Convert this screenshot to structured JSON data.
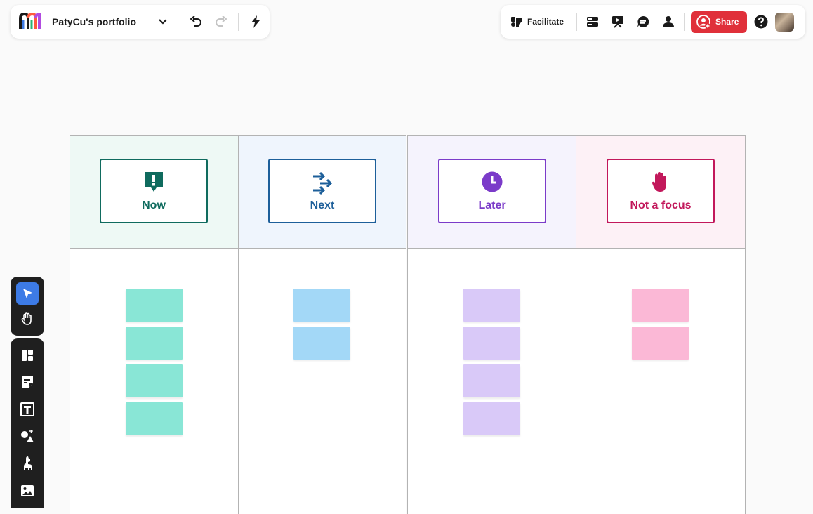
{
  "header": {
    "board_title": "PatyCu's portfolio",
    "facilitate_label": "Facilitate",
    "share_label": "Share"
  },
  "board": {
    "columns": [
      {
        "label": "Now",
        "icon": "exclamation-bubble-icon",
        "accent": "#0f6b5e",
        "header_bg": "#eef9f5",
        "sticky_color": "#89e6d6",
        "sticky_count": 4
      },
      {
        "label": "Next",
        "icon": "arrows-right-icon",
        "accent": "#1d5f9a",
        "header_bg": "#eff5fd",
        "sticky_color": "#a3d8f7",
        "sticky_count": 2
      },
      {
        "label": "Later",
        "icon": "clock-icon",
        "accent": "#7b3bc9",
        "header_bg": "#f5f3fd",
        "sticky_color": "#d9c9f8",
        "sticky_count": 4
      },
      {
        "label": "Not a focus",
        "icon": "hand-stop-icon",
        "accent": "#c2185b",
        "header_bg": "#fdf1f6",
        "sticky_color": "#fbb8d6",
        "sticky_count": 2
      }
    ]
  },
  "colors": {
    "share_button": "#e0303a",
    "toolbar_bg": "#1f1f1f",
    "active_tool": "#3d7be6"
  }
}
